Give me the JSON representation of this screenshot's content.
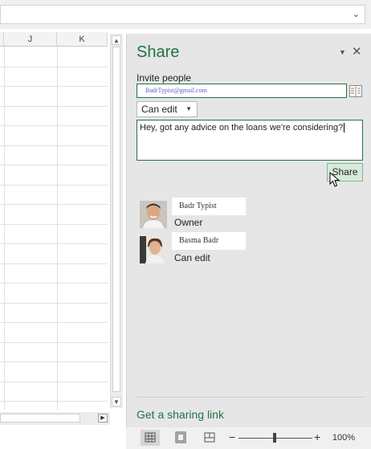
{
  "formula_bar": {
    "dropdown_icon": "chevron-down-icon"
  },
  "grid": {
    "columns": [
      "J",
      "K"
    ],
    "rows": 19
  },
  "share_pane": {
    "title": "Share",
    "menu_icon": "pane-options-icon",
    "close_icon": "close-icon",
    "invite_label": "Invite people",
    "invite_value": "BadrTypist@gmail.com",
    "address_book_icon": "address-book-icon",
    "permission": "Can edit",
    "message": "Hey, got any advice on the loans we're considering?",
    "share_button": "Share",
    "people": [
      {
        "name": "Badr Typist",
        "role": "Owner"
      },
      {
        "name": "Basma Badr",
        "role": "Can edit"
      }
    ],
    "sharing_link": "Get a sharing link"
  },
  "status_bar": {
    "views": [
      "normal-view-icon",
      "page-layout-view-icon",
      "page-break-preview-icon"
    ],
    "zoom_minus": "−",
    "zoom_plus": "+",
    "zoom_level": "100%"
  },
  "colors": {
    "accent": "#217346",
    "pane_bg": "#e6e6e6",
    "share_button_bg": "#d6ead9"
  }
}
